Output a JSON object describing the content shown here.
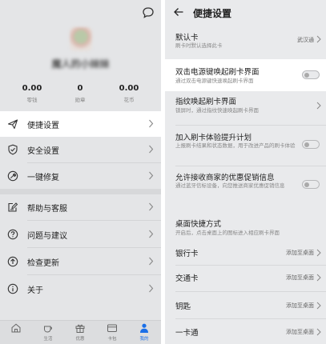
{
  "left": {
    "username": "魔人的小妹妹",
    "stats": [
      {
        "value": "0.00",
        "label": "零钱"
      },
      {
        "value": "0",
        "label": "勋章"
      },
      {
        "value": "0.00",
        "label": "花币"
      }
    ],
    "menu": [
      {
        "label": "便捷设置",
        "icon": "paper-plane-icon"
      },
      {
        "label": "安全设置",
        "icon": "shield-check-icon"
      },
      {
        "label": "一键修复",
        "icon": "wrench-icon"
      },
      {
        "label": "帮助与客服",
        "icon": "edit-note-icon"
      },
      {
        "label": "问题与建议",
        "icon": "question-icon"
      },
      {
        "label": "检查更新",
        "icon": "upload-arrow-icon"
      },
      {
        "label": "关于",
        "icon": "info-icon"
      }
    ],
    "tabs": [
      {
        "label": "",
        "icon": "home-icon"
      },
      {
        "label": "生活",
        "icon": "cup-icon"
      },
      {
        "label": "优惠",
        "icon": "gift-icon"
      },
      {
        "label": "卡包",
        "icon": "card-icon"
      },
      {
        "label": "我的",
        "icon": "person-icon"
      }
    ]
  },
  "right": {
    "title": "便捷设置",
    "default_card": {
      "title": "默认卡",
      "desc": "刷卡时默认选择此卡",
      "value": "武汉通"
    },
    "double_click": {
      "title": "双击电源键唤起刷卡界面",
      "desc": "通过双击电源键快速唤起刷卡界面"
    },
    "fingerprint": {
      "title": "指纹唤起刷卡界面",
      "desc": "锁屏时，通过指纹快速唤起刷卡界面"
    },
    "experience": {
      "title": "加入刷卡体验提升计划",
      "desc": "上报刷卡结果和状态数据，用于改进产品的刷卡体验"
    },
    "promo": {
      "title": "允许接收商家的优惠促销信息",
      "desc": "通过蓝牙信标设备，向您推送商家优惠促销信息"
    },
    "shortcut": {
      "title": "桌面快捷方式",
      "desc": "开启后，点击桌面上的图标进入相应刷卡界面"
    },
    "shortcut_items": [
      {
        "label": "银行卡",
        "action": "添加至桌面"
      },
      {
        "label": "交通卡",
        "action": "添加至桌面"
      },
      {
        "label": "钥匙",
        "action": "添加至桌面"
      },
      {
        "label": "一卡通",
        "action": "添加至桌面"
      }
    ]
  }
}
